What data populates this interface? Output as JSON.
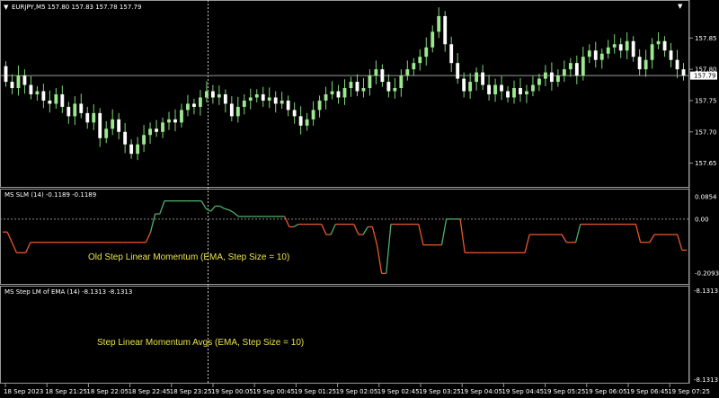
{
  "window": {
    "price_title": "EURJPY,M5  157.80 157.83 157.78 157.79",
    "ind1_title": "MS SLM (14) -0.1189 -0.1189",
    "ind2_title": "MS Step LM of EMA (14) -8.1313 -8.1313"
  },
  "price_axis": {
    "ticks": [
      "157.85",
      "157.80",
      "157.75",
      "157.70",
      "157.65"
    ],
    "tick_values": [
      157.85,
      157.8,
      157.75,
      157.7,
      157.65
    ],
    "current_price": "157.79",
    "current_value": 157.79
  },
  "ind1_axis": {
    "ticks": [
      "0.0854",
      "0.00",
      "-0.2093"
    ],
    "tick_values": [
      0.0854,
      0.0,
      -0.2093
    ]
  },
  "ind2_axis": {
    "ticks": [
      "-8.1313",
      "-8.1313"
    ]
  },
  "time_axis": {
    "labels": [
      "18 Sep 2023",
      "18 Sep 21:25",
      "18 Sep 22:05",
      "18 Sep 22:45",
      "18 Sep 23:25",
      "19 Sep 00:05",
      "19 Sep 00:45",
      "19 Sep 01:25",
      "19 Sep 02:05",
      "19 Sep 02:45",
      "19 Sep 03:25",
      "19 Sep 04:05",
      "19 Sep 04:45",
      "19 Sep 05:25",
      "19 Sep 06:05",
      "19 Sep 06:45",
      "19 Sep 07:25"
    ]
  },
  "annotations": {
    "ind1_text": "Old Step Linear Momentum (EMA, Step Size = 10)",
    "ind2_text": "Step Linear Momentum Avgs (EMA, Step Size = 10)"
  },
  "colors": {
    "bull": "#9be88e",
    "bear": "#ffffff",
    "wick": "#7fd67a",
    "line_up": "#4fb06a",
    "line_down": "#e8592c",
    "grid": "#808080",
    "annotation": "#e8e24a"
  },
  "chart_data": [
    {
      "type": "candlestick",
      "ylim": [
        157.615,
        157.905
      ],
      "candles": [
        {
          "o": 157.805,
          "c": 157.78
        },
        {
          "o": 157.78,
          "c": 157.77
        },
        {
          "o": 157.77,
          "c": 157.79
        },
        {
          "o": 157.79,
          "c": 157.775
        },
        {
          "o": 157.775,
          "c": 157.76
        },
        {
          "o": 157.76,
          "c": 157.765
        },
        {
          "o": 157.765,
          "c": 157.75
        },
        {
          "o": 157.75,
          "c": 157.745
        },
        {
          "o": 157.745,
          "c": 157.76
        },
        {
          "o": 157.76,
          "c": 157.74
        },
        {
          "o": 157.74,
          "c": 157.725
        },
        {
          "o": 157.725,
          "c": 157.745
        },
        {
          "o": 157.745,
          "c": 157.73
        },
        {
          "o": 157.73,
          "c": 157.715
        },
        {
          "o": 157.715,
          "c": 157.73
        },
        {
          "o": 157.73,
          "c": 157.69
        },
        {
          "o": 157.69,
          "c": 157.705
        },
        {
          "o": 157.705,
          "c": 157.72
        },
        {
          "o": 157.72,
          "c": 157.7
        },
        {
          "o": 157.7,
          "c": 157.68
        },
        {
          "o": 157.68,
          "c": 157.665
        },
        {
          "o": 157.665,
          "c": 157.68
        },
        {
          "o": 157.68,
          "c": 157.695
        },
        {
          "o": 157.695,
          "c": 157.705
        },
        {
          "o": 157.705,
          "c": 157.7
        },
        {
          "o": 157.7,
          "c": 157.715
        },
        {
          "o": 157.715,
          "c": 157.72
        },
        {
          "o": 157.72,
          "c": 157.715
        },
        {
          "o": 157.715,
          "c": 157.735
        },
        {
          "o": 157.735,
          "c": 157.745
        },
        {
          "o": 157.745,
          "c": 157.74
        },
        {
          "o": 157.74,
          "c": 157.755
        },
        {
          "o": 157.755,
          "c": 157.765
        },
        {
          "o": 157.765,
          "c": 157.755
        },
        {
          "o": 157.755,
          "c": 157.76
        },
        {
          "o": 157.76,
          "c": 157.745
        },
        {
          "o": 157.745,
          "c": 157.725
        },
        {
          "o": 157.725,
          "c": 157.74
        },
        {
          "o": 157.74,
          "c": 157.75
        },
        {
          "o": 157.75,
          "c": 157.755
        },
        {
          "o": 157.755,
          "c": 157.76
        },
        {
          "o": 157.76,
          "c": 157.75
        },
        {
          "o": 157.75,
          "c": 157.755
        },
        {
          "o": 157.755,
          "c": 157.745
        },
        {
          "o": 157.745,
          "c": 157.75
        },
        {
          "o": 157.75,
          "c": 157.735
        },
        {
          "o": 157.735,
          "c": 157.725
        },
        {
          "o": 157.725,
          "c": 157.71
        },
        {
          "o": 157.71,
          "c": 157.72
        },
        {
          "o": 157.72,
          "c": 157.735
        },
        {
          "o": 157.735,
          "c": 157.75
        },
        {
          "o": 157.75,
          "c": 157.76
        },
        {
          "o": 157.76,
          "c": 157.765
        },
        {
          "o": 157.765,
          "c": 157.755
        },
        {
          "o": 157.755,
          "c": 157.77
        },
        {
          "o": 157.77,
          "c": 157.78
        },
        {
          "o": 157.78,
          "c": 157.765
        },
        {
          "o": 157.765,
          "c": 157.77
        },
        {
          "o": 157.77,
          "c": 157.79
        },
        {
          "o": 157.79,
          "c": 157.8
        },
        {
          "o": 157.8,
          "c": 157.78
        },
        {
          "o": 157.78,
          "c": 157.765
        },
        {
          "o": 157.765,
          "c": 157.77
        },
        {
          "o": 157.77,
          "c": 157.79
        },
        {
          "o": 157.79,
          "c": 157.8
        },
        {
          "o": 157.8,
          "c": 157.81
        },
        {
          "o": 157.81,
          "c": 157.82
        },
        {
          "o": 157.82,
          "c": 157.835
        },
        {
          "o": 157.835,
          "c": 157.86
        },
        {
          "o": 157.86,
          "c": 157.885
        },
        {
          "o": 157.885,
          "c": 157.84
        },
        {
          "o": 157.84,
          "c": 157.81
        },
        {
          "o": 157.81,
          "c": 157.785
        },
        {
          "o": 157.785,
          "c": 157.765
        },
        {
          "o": 157.765,
          "c": 157.78
        },
        {
          "o": 157.78,
          "c": 157.795
        },
        {
          "o": 157.795,
          "c": 157.775
        },
        {
          "o": 157.775,
          "c": 157.76
        },
        {
          "o": 157.76,
          "c": 157.775
        },
        {
          "o": 157.775,
          "c": 157.765
        },
        {
          "o": 157.765,
          "c": 157.755
        },
        {
          "o": 157.755,
          "c": 157.77
        },
        {
          "o": 157.77,
          "c": 157.76
        },
        {
          "o": 157.76,
          "c": 157.765
        },
        {
          "o": 157.765,
          "c": 157.775
        },
        {
          "o": 157.775,
          "c": 157.785
        },
        {
          "o": 157.785,
          "c": 157.795
        },
        {
          "o": 157.795,
          "c": 157.78
        },
        {
          "o": 157.78,
          "c": 157.79
        },
        {
          "o": 157.79,
          "c": 157.8
        },
        {
          "o": 157.8,
          "c": 157.81
        },
        {
          "o": 157.81,
          "c": 157.79
        },
        {
          "o": 157.79,
          "c": 157.82
        },
        {
          "o": 157.82,
          "c": 157.83
        },
        {
          "o": 157.83,
          "c": 157.815
        },
        {
          "o": 157.815,
          "c": 157.825
        },
        {
          "o": 157.825,
          "c": 157.835
        },
        {
          "o": 157.835,
          "c": 157.84
        },
        {
          "o": 157.84,
          "c": 157.83
        },
        {
          "o": 157.83,
          "c": 157.845
        },
        {
          "o": 157.845,
          "c": 157.82
        },
        {
          "o": 157.82,
          "c": 157.8
        },
        {
          "o": 157.8,
          "c": 157.815
        },
        {
          "o": 157.815,
          "c": 157.84
        },
        {
          "o": 157.84,
          "c": 157.845
        },
        {
          "o": 157.845,
          "c": 157.83
        },
        {
          "o": 157.83,
          "c": 157.815
        },
        {
          "o": 157.815,
          "c": 157.8
        },
        {
          "o": 157.8,
          "c": 157.79
        }
      ]
    },
    {
      "type": "line",
      "name": "MS SLM (14)",
      "ylim": [
        -0.24,
        0.1
      ],
      "step_values": [
        -0.05,
        -0.05,
        -0.09,
        -0.13,
        -0.13,
        -0.13,
        -0.09,
        -0.09,
        -0.09,
        -0.09,
        -0.09,
        -0.09,
        -0.09,
        -0.09,
        -0.09,
        -0.09,
        -0.09,
        -0.09,
        -0.09,
        -0.09,
        -0.09,
        -0.09,
        -0.09,
        -0.09,
        -0.09,
        -0.09,
        -0.09,
        -0.09,
        -0.09,
        -0.09,
        -0.09,
        -0.09,
        -0.05,
        0.02,
        0.02,
        0.07,
        0.07,
        0.07,
        0.07,
        0.07,
        0.07,
        0.07,
        0.07,
        0.07,
        0.04,
        0.03,
        0.05,
        0.05,
        0.04,
        0.035,
        0.025,
        0.01,
        0.01,
        0.01,
        0.01,
        0.01,
        0.01,
        0.01,
        0.01,
        0.01,
        0.01,
        0.01,
        -0.03,
        -0.03,
        -0.02,
        -0.02,
        -0.02,
        -0.02,
        -0.02,
        -0.02,
        -0.06,
        -0.06,
        -0.02,
        -0.02,
        -0.02,
        -0.02,
        -0.02,
        -0.06,
        -0.06,
        -0.03,
        -0.03,
        -0.1,
        -0.21,
        -0.21,
        -0.02,
        -0.02,
        -0.02,
        -0.02,
        -0.02,
        -0.02,
        -0.02,
        -0.1,
        -0.1,
        -0.1,
        -0.1,
        -0.1,
        0.0,
        0.0,
        0.0,
        0.0,
        -0.13,
        -0.13,
        -0.13,
        -0.13,
        -0.13,
        -0.13,
        -0.13,
        -0.13,
        -0.13,
        -0.13,
        -0.13,
        -0.13,
        -0.13,
        -0.13,
        -0.06,
        -0.06,
        -0.06,
        -0.06,
        -0.06,
        -0.06,
        -0.06,
        -0.06,
        -0.09,
        -0.09,
        -0.09,
        -0.02,
        -0.02,
        -0.02,
        -0.02,
        -0.02,
        -0.02,
        -0.02,
        -0.02,
        -0.02,
        -0.02,
        -0.02,
        -0.02,
        -0.02,
        -0.09,
        -0.09,
        -0.09,
        -0.06,
        -0.06,
        -0.06,
        -0.06,
        -0.06,
        -0.06,
        -0.12,
        -0.12
      ]
    }
  ]
}
